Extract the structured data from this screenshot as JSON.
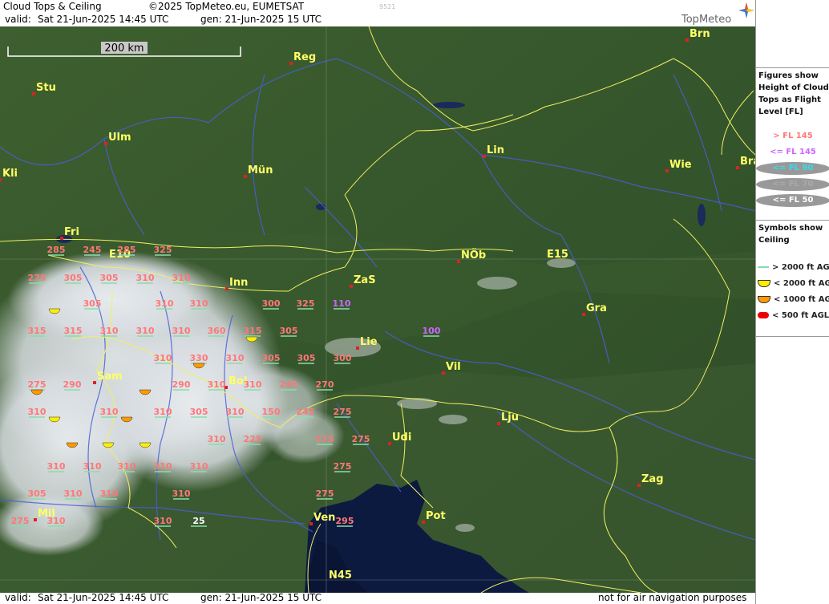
{
  "header": {
    "title": "Cloud Tops & Ceiling",
    "copyright": "©2025 TopMeteo.eu, EUMETSAT",
    "valid_label": "valid:",
    "valid": "Sat   21-Jun-2025  14:45 UTC",
    "gen": "gen: 21-Jun-2025 15 UTC",
    "code": "9521",
    "brand": "TopMeteo"
  },
  "footer": {
    "valid_label": "valid:",
    "valid": "Sat   21-Jun-2025  14:45 UTC",
    "gen": "gen: 21-Jun-2025 15 UTC",
    "disclaimer": "not for air navigation purposes"
  },
  "scale_bar": {
    "label": "200 km"
  },
  "grid_labels": [
    "E10",
    "E15",
    "N45"
  ],
  "cities": [
    "Brn",
    "Reg",
    "Stu",
    "Ulm",
    "Lin",
    "Mün",
    "Wie",
    "Bra",
    "Kli",
    "Fri",
    "NÖb",
    "Inn",
    "ZaS",
    "Gra",
    "Lie",
    "Vil",
    "Sam",
    "Bol",
    "Lju",
    "Udi",
    "Zag",
    "Pot",
    "Mil",
    "Ven"
  ],
  "legend_tops": {
    "title": "Figures show Height of Cloud Tops as Flight Level  [FL]",
    "items": [
      {
        "label": "> FL 145",
        "color": "#ff7777"
      },
      {
        "label": "<= FL 145",
        "color": "#cc66ff"
      },
      {
        "label": "<= FL 90",
        "color": "#33ddee"
      },
      {
        "label": "<= FL 70",
        "color": "#aaaaaa"
      },
      {
        "label": "<= FL 50",
        "color": "#ffffff"
      }
    ]
  },
  "legend_ceiling": {
    "title": "Symbols show Ceiling",
    "items": [
      {
        "label": "> 2000 ft AGL",
        "color": "#88ddaa"
      },
      {
        "label": "< 2000 ft AGL",
        "color": "#ffee00"
      },
      {
        "label": "< 1000 ft AGL",
        "color": "#ff9900"
      },
      {
        "label": "< 500 ft AGL",
        "color": "#ee0000"
      }
    ]
  },
  "cloud_tops": [
    "285",
    "245",
    "285",
    "325",
    "275",
    "305",
    "305",
    "310",
    "310",
    "305",
    "310",
    "310",
    "300",
    "325",
    "110",
    "315",
    "315",
    "310",
    "310",
    "310",
    "360",
    "315",
    "305",
    "100",
    "310",
    "330",
    "310",
    "305",
    "305",
    "300",
    "290",
    "275",
    "290",
    "310",
    "310",
    "245",
    "270",
    "310",
    "310",
    "150",
    "245",
    "275",
    "310",
    "305",
    "310",
    "310",
    "225",
    "275",
    "275",
    "275",
    "310",
    "310",
    "310",
    "310",
    "310",
    "305",
    "310",
    "310",
    "310",
    "275",
    "275",
    "310",
    "310",
    "295",
    "25"
  ]
}
